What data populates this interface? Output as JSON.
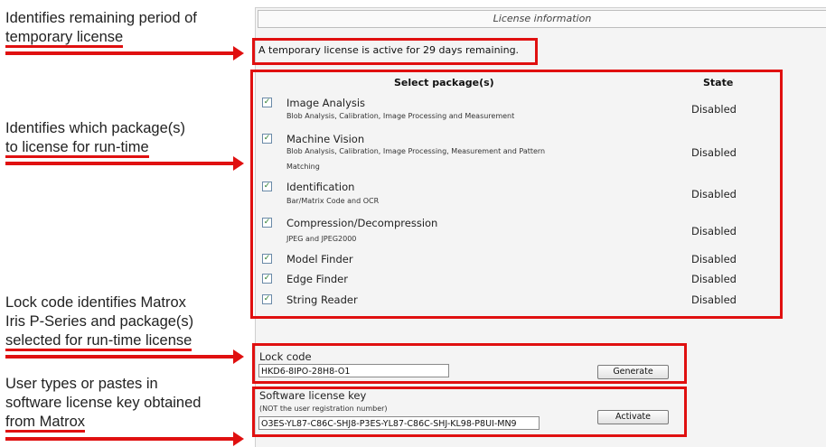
{
  "annotations": {
    "a1_line1": "Identifies remaining period of",
    "a1_line2": "temporary license",
    "a2_line1": "Identifies which package(s)",
    "a2_line2": "to license for run-time",
    "a3_line1": "Lock code identifies Matrox",
    "a3_line2": "Iris P-Series and package(s)",
    "a3_line3": "selected for run-time license",
    "a4_line1": "User types or pastes in",
    "a4_line2": "software license key obtained",
    "a4_line3": "from Matrox"
  },
  "panel": {
    "title": "License information",
    "temp_notice": "A temporary license is active for 29 days remaining."
  },
  "table": {
    "col_package": "Select package(s)",
    "col_state": "State",
    "packages": [
      {
        "name": "Image Analysis",
        "desc": "Blob Analysis, Calibration, Image Processing and Measurement",
        "state": "Disabled",
        "checked": true
      },
      {
        "name": "Machine Vision",
        "desc": "Blob Analysis, Calibration, Image Processing, Measurement and Pattern",
        "desc2": "Matching",
        "state": "Disabled",
        "checked": true
      },
      {
        "name": "Identification",
        "desc": "Bar/Matrix Code and OCR",
        "state": "Disabled",
        "checked": true
      },
      {
        "name": "Compression/Decompression",
        "desc": "JPEG and JPEG2000",
        "state": "Disabled",
        "checked": true
      },
      {
        "name": "Model Finder",
        "state": "Disabled",
        "checked": true
      },
      {
        "name": "Edge Finder",
        "state": "Disabled",
        "checked": true
      },
      {
        "name": "String Reader",
        "state": "Disabled",
        "checked": true
      }
    ]
  },
  "lock": {
    "label": "Lock code",
    "value": "HKD6-8IPO-28H8-O1",
    "generate_label": "Generate"
  },
  "software": {
    "label": "Software license key",
    "sublabel": "(NOT the user registration number)",
    "value": "O3ES-YL87-C86C-SHJ8-P3ES-YL87-C86C-SHJ-KL98-P8UI-MN9",
    "activate_label": "Activate"
  },
  "colors": {
    "highlight": "#e01010"
  }
}
